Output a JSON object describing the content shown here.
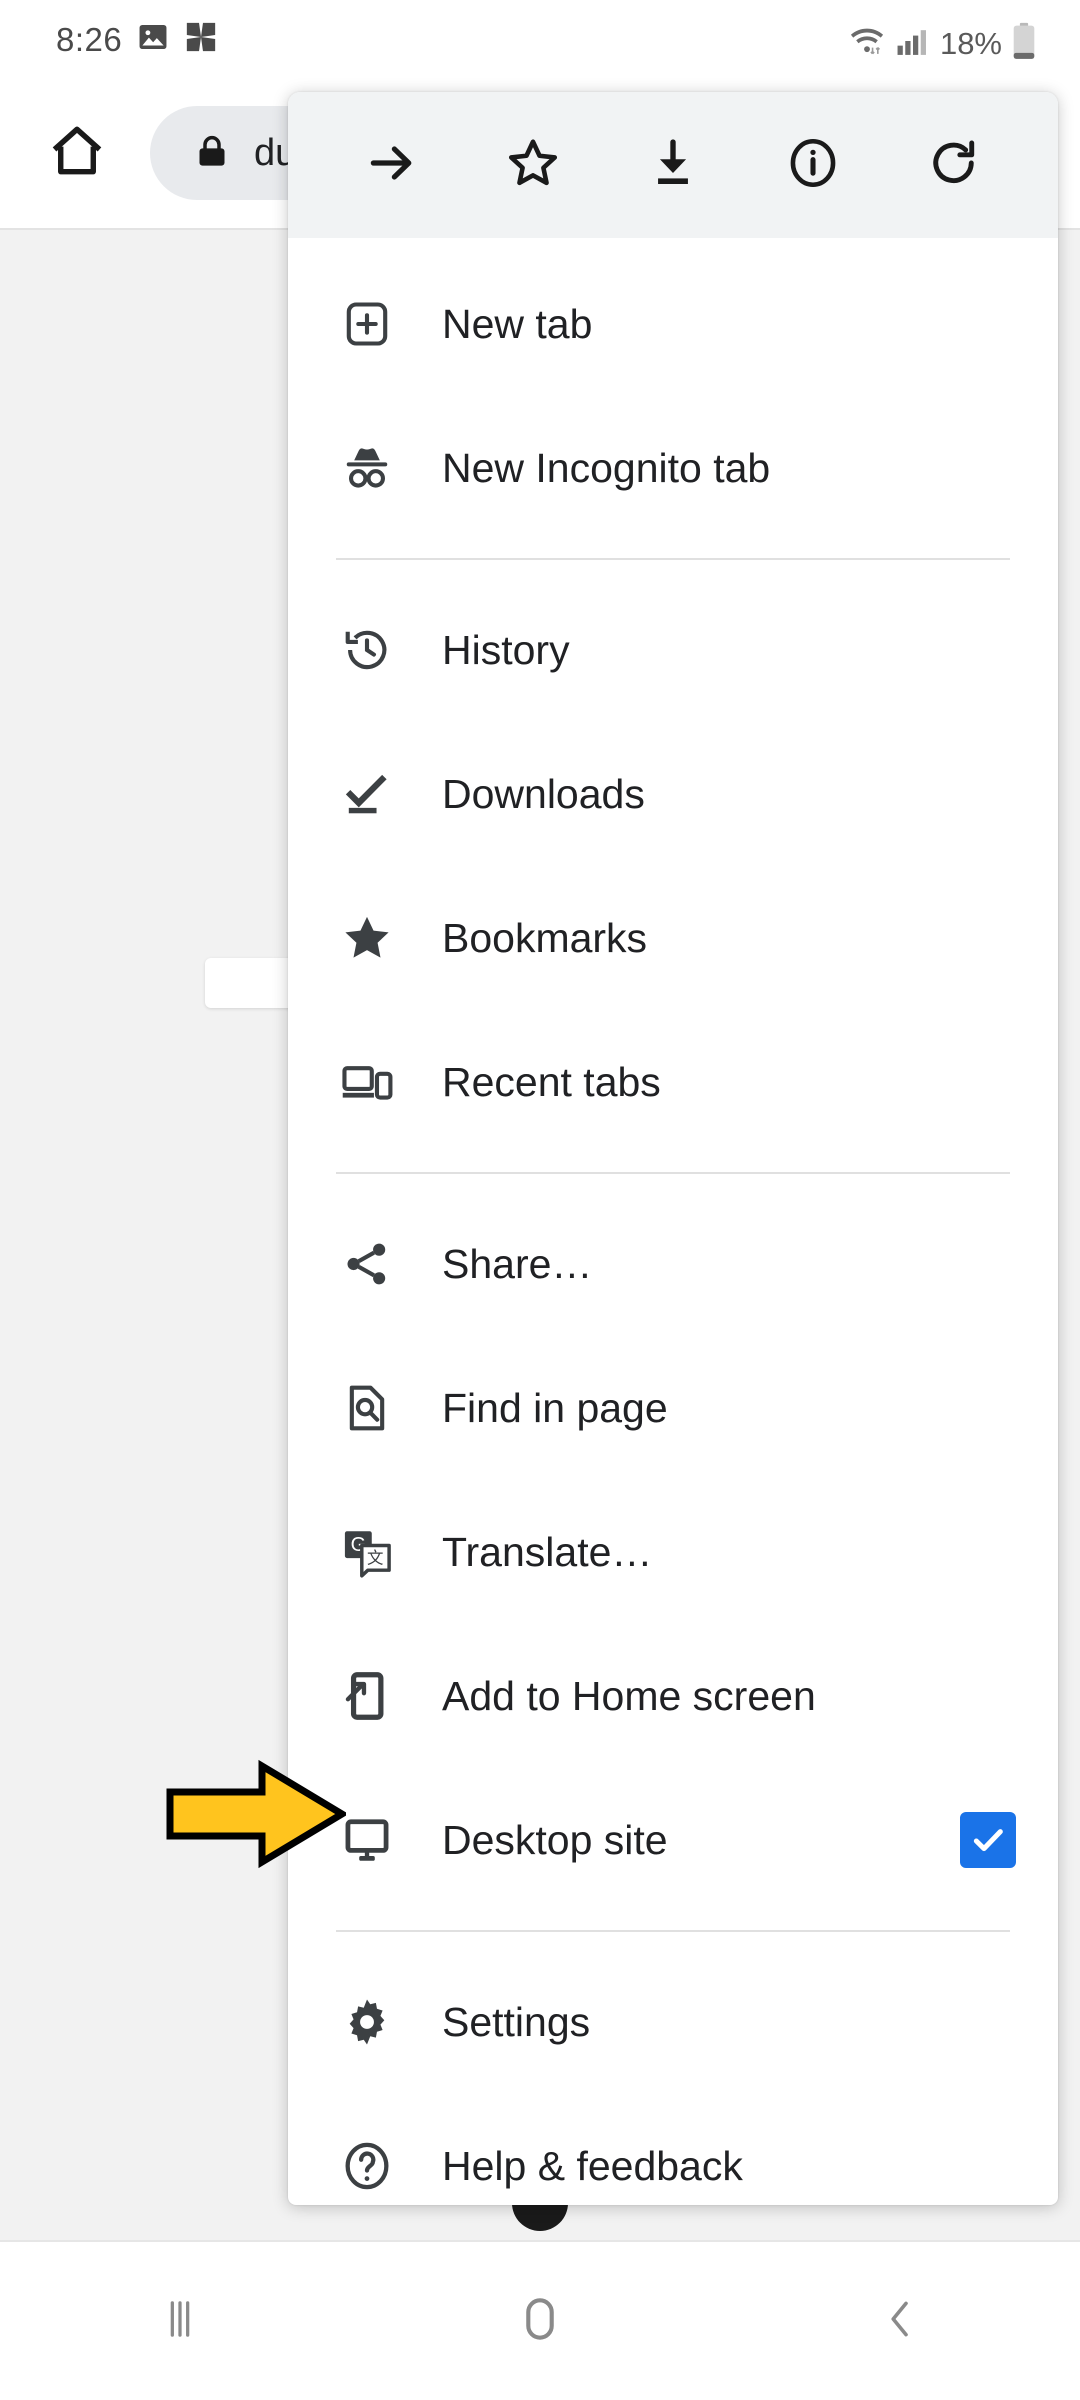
{
  "status_bar": {
    "clock": "8:26",
    "battery_percent": "18%",
    "icons": [
      "image-icon",
      "app-pinwheel-icon",
      "wifi-icon",
      "cellular-signal-icon",
      "battery-icon"
    ]
  },
  "browser_toolbar": {
    "home_icon": "home-icon",
    "lock_icon": "lock-icon",
    "url_text": "du"
  },
  "menu": {
    "header_actions": [
      {
        "name": "forward-button",
        "icon": "arrow-forward-icon"
      },
      {
        "name": "bookmark-button",
        "icon": "star-outline-icon"
      },
      {
        "name": "download-button",
        "icon": "download-icon"
      },
      {
        "name": "page-info-button",
        "icon": "info-circle-icon"
      },
      {
        "name": "reload-button",
        "icon": "reload-icon"
      }
    ],
    "groups": [
      {
        "items": [
          {
            "label": "New tab",
            "icon": "new-tab-icon",
            "checkbox": null
          },
          {
            "label": "New Incognito tab",
            "icon": "incognito-icon",
            "checkbox": null
          }
        ]
      },
      {
        "items": [
          {
            "label": "History",
            "icon": "history-icon",
            "checkbox": null
          },
          {
            "label": "Downloads",
            "icon": "downloads-icon",
            "checkbox": null
          },
          {
            "label": "Bookmarks",
            "icon": "star-filled-icon",
            "checkbox": null
          },
          {
            "label": "Recent tabs",
            "icon": "recent-tabs-icon",
            "checkbox": null
          }
        ]
      },
      {
        "items": [
          {
            "label": "Share…",
            "icon": "share-icon",
            "checkbox": null
          },
          {
            "label": "Find in page",
            "icon": "find-in-page-icon",
            "checkbox": null
          },
          {
            "label": "Translate…",
            "icon": "translate-icon",
            "checkbox": null
          },
          {
            "label": "Add to Home screen",
            "icon": "add-to-home-screen-icon",
            "checkbox": null
          },
          {
            "label": "Desktop site",
            "icon": "desktop-site-icon",
            "checkbox": "checked"
          }
        ]
      },
      {
        "items": [
          {
            "label": "Settings",
            "icon": "gear-icon",
            "checkbox": null
          },
          {
            "label": "Help & feedback",
            "icon": "help-circle-icon",
            "checkbox": null
          }
        ]
      }
    ]
  },
  "annotation": {
    "arrow": "yellow-right-arrow",
    "points_at": "Desktop site"
  },
  "nav_bar": {
    "buttons": [
      {
        "name": "recents-button",
        "icon": "recents-icon"
      },
      {
        "name": "home-button",
        "icon": "home-pill-icon"
      },
      {
        "name": "back-button",
        "icon": "back-chevron-icon"
      }
    ]
  },
  "colors": {
    "checkbox_blue": "#1a73e8",
    "menu_header_bg": "#f1f3f4",
    "page_bg": "#f2f2f2",
    "annotation_yellow": "#ffc41e",
    "icon_gray": "#3c4043"
  }
}
